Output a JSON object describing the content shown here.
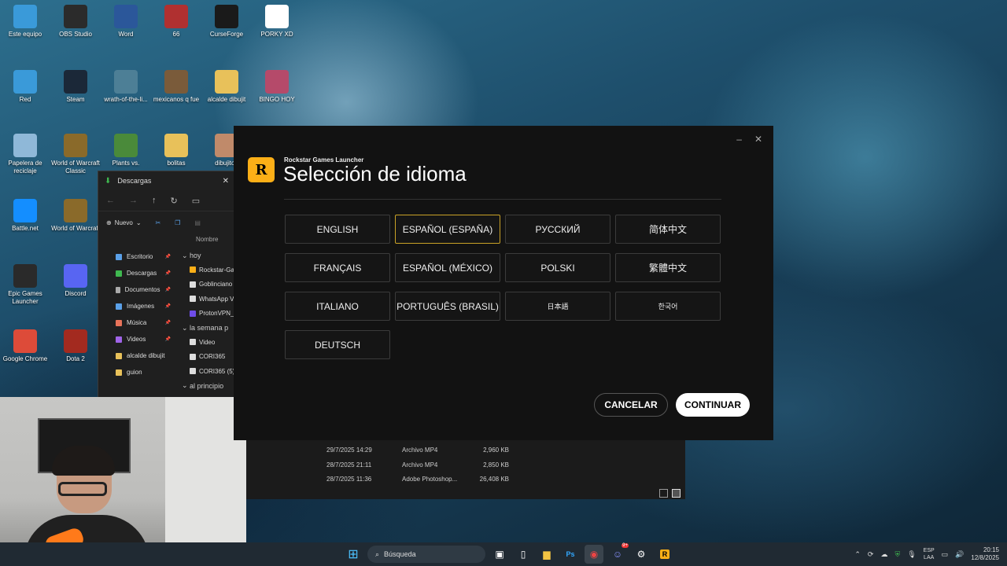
{
  "desktop": {
    "icons": [
      {
        "label": "Este equipo",
        "icon": "monitor-icon",
        "color": "#3a9ad9"
      },
      {
        "label": "OBS Studio",
        "icon": "obs-icon",
        "color": "#2b2b2b"
      },
      {
        "label": "Word",
        "icon": "word-icon",
        "color": "#2b579a"
      },
      {
        "label": "66",
        "icon": "image-icon",
        "color": "#b03030"
      },
      {
        "label": "CurseForge",
        "icon": "curseforge-icon",
        "color": "#1a1a1a"
      },
      {
        "label": "PORKY XD",
        "icon": "video-icon",
        "color": "#ffffff"
      },
      {
        "label": "Red",
        "icon": "network-icon",
        "color": "#3a9ad9"
      },
      {
        "label": "Steam",
        "icon": "steam-icon",
        "color": "#1b2838"
      },
      {
        "label": "wrath-of-the-li...",
        "icon": "image-icon",
        "color": "#4d7f96"
      },
      {
        "label": "mexicanos q fue",
        "icon": "image-icon",
        "color": "#7a5b3a"
      },
      {
        "label": "alcalde dibujit",
        "icon": "folder-icon",
        "color": "#e8c15a"
      },
      {
        "label": "BINGO HOY",
        "icon": "image-icon",
        "color": "#b54a6a"
      },
      {
        "label": "Papelera de reciclaje",
        "icon": "recycle-bin-icon",
        "color": "#8fb8d8"
      },
      {
        "label": "World of Warcraft Classic",
        "icon": "wow-icon",
        "color": "#8a6a2a"
      },
      {
        "label": "Plants vs.",
        "icon": "plants-icon",
        "color": "#4a8a3a"
      },
      {
        "label": "bolitas",
        "icon": "folder-icon",
        "color": "#e8c15a"
      },
      {
        "label": "dibujitop",
        "icon": "image-icon",
        "color": "#c08a6a"
      },
      {
        "label": "Battle.net",
        "icon": "battlenet-icon",
        "color": "#148eff"
      },
      {
        "label": "World of Warcraft",
        "icon": "wow-icon",
        "color": "#8a6a2a"
      },
      {
        "label": "Epic Games Launcher",
        "icon": "epic-icon",
        "color": "#2a2a2a"
      },
      {
        "label": "Discord",
        "icon": "discord-icon",
        "color": "#5865f2"
      },
      {
        "label": "Google Chrome",
        "icon": "chrome-icon",
        "color": "#dd4b39"
      },
      {
        "label": "Dota 2",
        "icon": "dota-icon",
        "color": "#a32a1f"
      }
    ]
  },
  "explorer": {
    "title": "Descargas",
    "new_label": "Nuevo",
    "column_name": "Nombre",
    "nav_items": [
      "Escritorio",
      "Descargas",
      "Documentos",
      "Imágenes",
      "Música",
      "Videos",
      "alcalde dibujit",
      "guion"
    ],
    "groups": {
      "today": "hoy",
      "week": "la semana p",
      "earlier": "al principio"
    },
    "today_files": [
      "Rockstar-Ga",
      "Goblinciano",
      "WhatsApp V",
      "ProtonVPN_"
    ],
    "week_files": [
      "Video",
      "CORI365",
      "CORI365 (5)"
    ],
    "details_rows": [
      {
        "date": "29/7/2025 14:29",
        "type": "Archivo MP4",
        "size": "2,960 KB"
      },
      {
        "date": "28/7/2025 21:11",
        "type": "Archivo MP4",
        "size": "2,850 KB"
      },
      {
        "date": "28/7/2025 11:36",
        "type": "Adobe Photoshop...",
        "size": "26,408 KB"
      }
    ]
  },
  "dialog": {
    "app_name": "Rockstar Games Launcher",
    "title": "Selección de idioma",
    "logo_text": "R",
    "minimize_glyph": "–",
    "close_glyph": "✕",
    "languages": [
      {
        "label": "ENGLISH",
        "selected": false
      },
      {
        "label": "ESPAÑOL (ESPAÑA)",
        "selected": true
      },
      {
        "label": "РУССКИЙ",
        "selected": false
      },
      {
        "label": "简体中文",
        "selected": false
      },
      {
        "label": "FRANÇAIS",
        "selected": false
      },
      {
        "label": "ESPAÑOL (MÉXICO)",
        "selected": false
      },
      {
        "label": "POLSKI",
        "selected": false
      },
      {
        "label": "繁體中文",
        "selected": false
      },
      {
        "label": "ITALIANO",
        "selected": false
      },
      {
        "label": "PORTUGUÊS (BRASIL)",
        "selected": false
      },
      {
        "label": "日本語",
        "selected": false
      },
      {
        "label": "한국어",
        "selected": false
      },
      {
        "label": "DEUTSCH",
        "selected": false
      }
    ],
    "cancel_label": "CANCELAR",
    "continue_label": "CONTINUAR",
    "accent_color": "#fcaf17"
  },
  "taskbar": {
    "search_placeholder": "Búsqueda",
    "lang_line1": "ESP",
    "lang_line2": "LAA",
    "time": "20:15",
    "date": "12/8/2025",
    "discord_badge": "9+"
  }
}
